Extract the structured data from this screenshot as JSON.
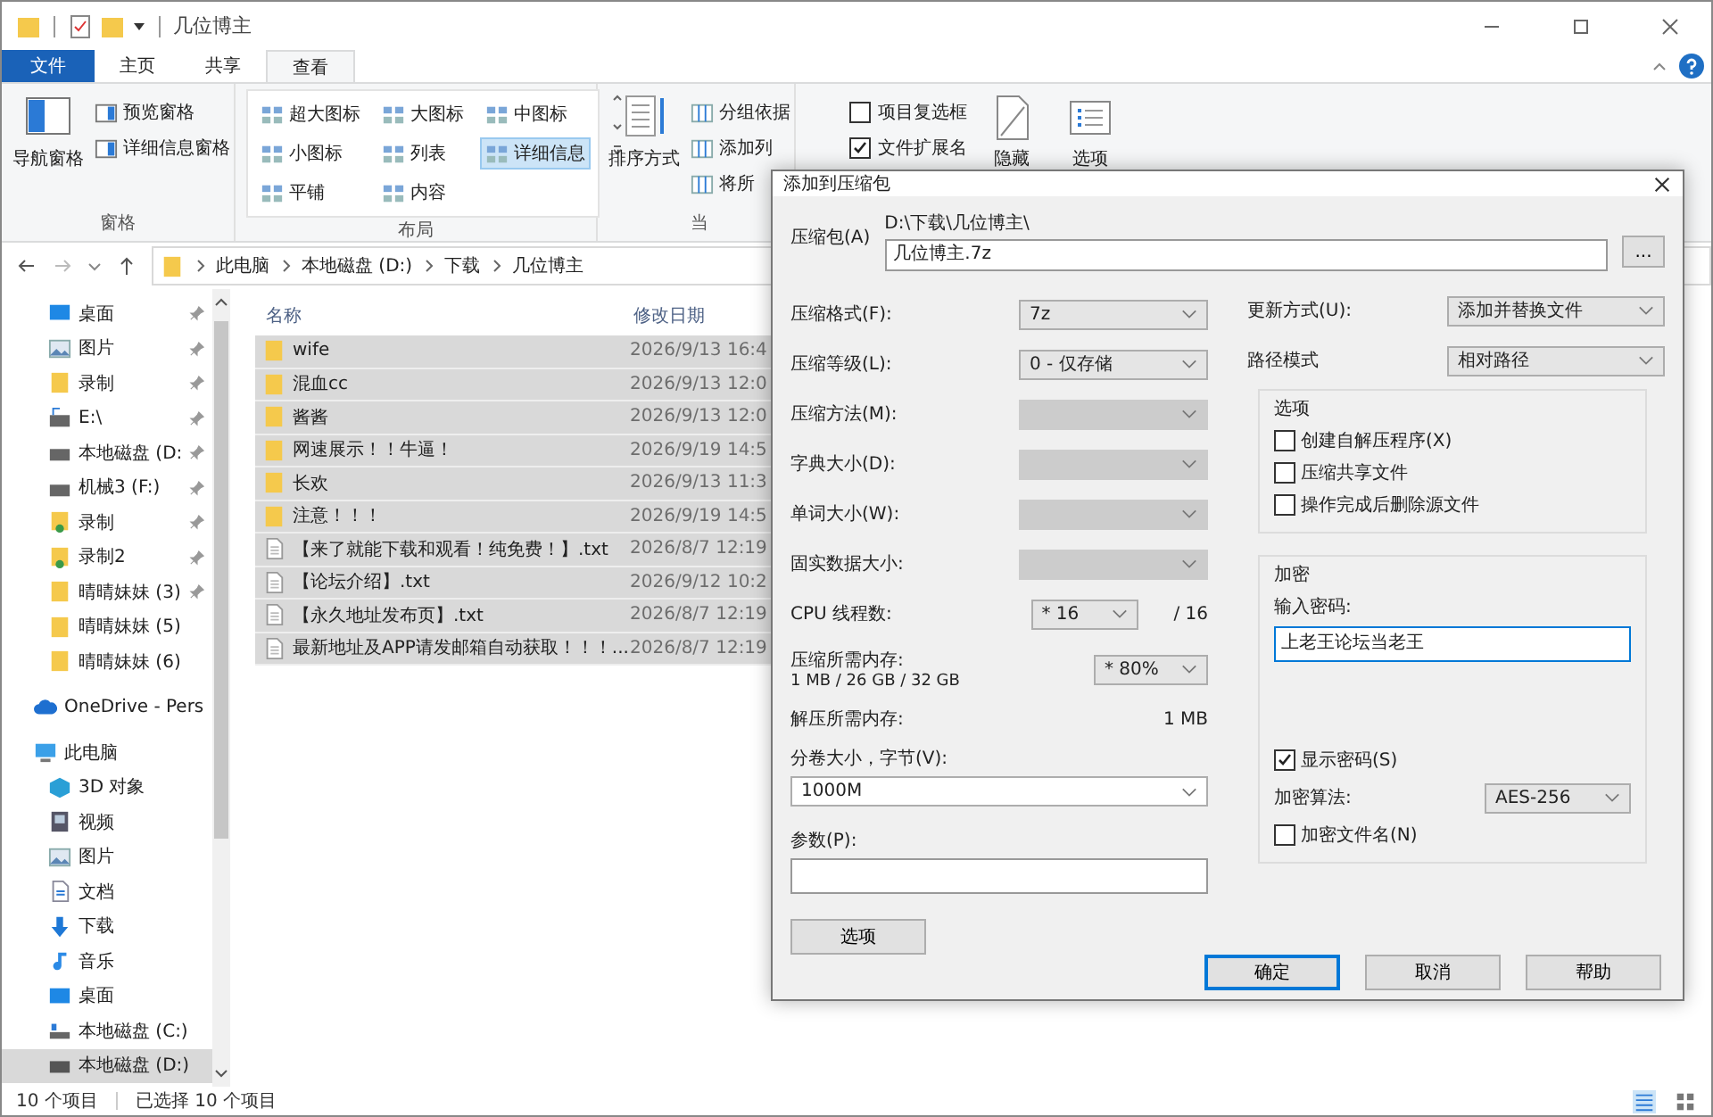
{
  "window": {
    "title": "几位博主"
  },
  "ribbon": {
    "tabs": [
      {
        "label": "文件",
        "kind": "file",
        "selected": false
      },
      {
        "label": "主页",
        "kind": "tab",
        "selected": false
      },
      {
        "label": "共享",
        "kind": "tab",
        "selected": false
      },
      {
        "label": "查看",
        "kind": "tab",
        "selected": true
      }
    ],
    "panes": {
      "nav_pane": "导航窗格",
      "items": [
        "预览窗格",
        "详细信息窗格"
      ],
      "label": "窗格"
    },
    "layout": {
      "items": [
        {
          "label": "超大图标",
          "selected": false
        },
        {
          "label": "大图标",
          "selected": false
        },
        {
          "label": "中图标",
          "selected": false
        },
        {
          "label": "小图标",
          "selected": false
        },
        {
          "label": "列表",
          "selected": false
        },
        {
          "label": "详细信息",
          "selected": true
        },
        {
          "label": "平铺",
          "selected": false
        },
        {
          "label": "内容",
          "selected": false
        }
      ],
      "label": "布局"
    },
    "current_view": {
      "sort": "排序方式",
      "items": [
        "分组依据",
        "添加列",
        "将所"
      ],
      "label": "当"
    },
    "show_hide": {
      "checks": [
        {
          "label": "项目复选框",
          "checked": false
        },
        {
          "label": "文件扩展名",
          "checked": true
        }
      ],
      "hide": "隐藏",
      "options": "选项"
    }
  },
  "address": {
    "crumbs": [
      "此电脑",
      "本地磁盘 (D:)",
      "下载",
      "几位博主"
    ]
  },
  "nav": {
    "quick": [
      {
        "label": "桌面",
        "kind": "desktop",
        "pinned": true
      },
      {
        "label": "图片",
        "kind": "picture",
        "pinned": true
      },
      {
        "label": "录制",
        "kind": "folder",
        "pinned": true
      },
      {
        "label": "E:\\",
        "kind": "netdrive",
        "pinned": true
      },
      {
        "label": "本地磁盘 (D:",
        "kind": "drive",
        "pinned": true
      },
      {
        "label": "机械3 (F:)",
        "kind": "drive",
        "pinned": true
      },
      {
        "label": "录制",
        "kind": "userfolder",
        "pinned": true
      },
      {
        "label": "录制2",
        "kind": "userfolder",
        "pinned": true
      },
      {
        "label": "晴晴妹妹 (3)",
        "kind": "folder",
        "pinned": true
      },
      {
        "label": "晴晴妹妹 (5)",
        "kind": "folder",
        "pinned": false
      },
      {
        "label": "晴晴妹妹 (6)",
        "kind": "folder",
        "pinned": false
      }
    ],
    "onedrive": "OneDrive - Pers",
    "pc": {
      "label": "此电脑",
      "children": [
        {
          "label": "3D 对象",
          "kind": "cube",
          "selected": false
        },
        {
          "label": "视频",
          "kind": "video",
          "selected": false
        },
        {
          "label": "图片",
          "kind": "picture",
          "selected": false
        },
        {
          "label": "文档",
          "kind": "doc",
          "selected": false
        },
        {
          "label": "下载",
          "kind": "download",
          "selected": false
        },
        {
          "label": "音乐",
          "kind": "music",
          "selected": false
        },
        {
          "label": "桌面",
          "kind": "desktop",
          "selected": false
        },
        {
          "label": "本地磁盘 (C:)",
          "kind": "sysdrive",
          "selected": false
        },
        {
          "label": "本地磁盘 (D:)",
          "kind": "drive",
          "selected": true
        }
      ]
    }
  },
  "files": {
    "columns": [
      "名称",
      "修改日期"
    ],
    "rows": [
      {
        "name": "wife",
        "date": "2026/9/13 16:4",
        "kind": "folder",
        "selected": true
      },
      {
        "name": "混血cc",
        "date": "2026/9/13 12:0",
        "kind": "folder",
        "selected": true
      },
      {
        "name": "酱酱",
        "date": "2026/9/13 12:0",
        "kind": "folder",
        "selected": true
      },
      {
        "name": "网速展示！！牛逼！",
        "date": "2026/9/19 14:5",
        "kind": "folder",
        "selected": true
      },
      {
        "name": "长欢",
        "date": "2026/9/13 11:3",
        "kind": "folder",
        "selected": true
      },
      {
        "name": "注意！！！",
        "date": "2026/9/19 14:5",
        "kind": "folder",
        "selected": true
      },
      {
        "name": "【来了就能下载和观看！纯免费！】.txt",
        "date": "2026/8/7 12:19",
        "kind": "text",
        "selected": true
      },
      {
        "name": "【论坛介绍】.txt",
        "date": "2026/9/12 10:2",
        "kind": "text",
        "selected": true
      },
      {
        "name": "【永久地址发布页】.txt",
        "date": "2026/8/7 12:19",
        "kind": "text",
        "selected": true
      },
      {
        "name": "最新地址及APP请发邮箱自动获取！！！...",
        "date": "2026/8/7 12:19",
        "kind": "text",
        "selected": true
      }
    ]
  },
  "status_bar": {
    "count": "10 个项目",
    "selection": "已选择 10 个项目"
  },
  "dialog": {
    "title": "添加到压缩包",
    "archive_label": "压缩包(A)",
    "archive_dir": "D:\\下载\\几位博主\\",
    "archive_name": "几位博主.7z",
    "browse": "...",
    "left": [
      {
        "kind": "select",
        "label": "压缩格式(F):",
        "value": "7z",
        "disabled": false
      },
      {
        "kind": "select",
        "label": "压缩等级(L):",
        "value": "0 - 仅存储",
        "disabled": false
      },
      {
        "kind": "select",
        "label": "压缩方法(M):",
        "disabled": true
      },
      {
        "kind": "select",
        "label": "字典大小(D):",
        "disabled": true
      },
      {
        "kind": "select",
        "label": "单词大小(W):",
        "disabled": true
      },
      {
        "kind": "select",
        "label": "固实数据大小:",
        "disabled": true
      },
      {
        "kind": "cpu",
        "label": "CPU 线程数:",
        "value": "* 16",
        "note": "/ 16",
        "disabled": false
      },
      {
        "kind": "memory",
        "label": "压缩所需内存:",
        "sub": "1 MB / 26 GB / 32 GB",
        "value": "* 80%",
        "disabled": false
      },
      {
        "kind": "info",
        "label": "解压所需内存:",
        "note": "1 MB"
      }
    ],
    "volume": {
      "label": "分卷大小，字节(V):",
      "value": "1000M"
    },
    "params": {
      "label": "参数(P):"
    },
    "options_button": "选项",
    "update": {
      "label": "更新方式(U):",
      "value": "添加并替换文件"
    },
    "path_mode": {
      "label": "路径模式",
      "value": "相对路径"
    },
    "options": {
      "title": "选项",
      "checks": [
        {
          "label": "创建自解压程序(X)",
          "checked": false
        },
        {
          "label": "压缩共享文件",
          "checked": false
        },
        {
          "label": "操作完成后删除源文件",
          "checked": false
        }
      ]
    },
    "encryption": {
      "title": "加密",
      "password_label": "输入密码:",
      "password": "上老王论坛当老王",
      "show_password": {
        "label": "显示密码(S)",
        "checked": true
      },
      "method_label": "加密算法:",
      "method": "AES-256",
      "encrypt_names": {
        "label": "加密文件名(N)",
        "checked": false
      }
    },
    "buttons": [
      {
        "label": "确定",
        "default": true
      },
      {
        "label": "取消",
        "default": false
      },
      {
        "label": "帮助",
        "default": false
      }
    ]
  }
}
